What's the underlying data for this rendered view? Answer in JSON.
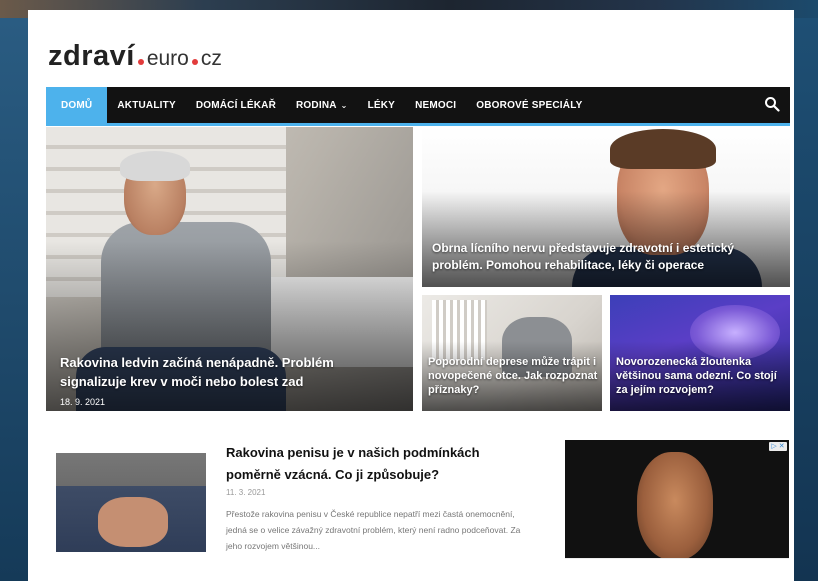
{
  "logo": {
    "main": "zdraví",
    "sub1": "euro",
    "sub2": "cz"
  },
  "nav": {
    "items": [
      {
        "label": "DOMŮ",
        "active": true
      },
      {
        "label": "AKTUALITY"
      },
      {
        "label": "DOMÁCÍ LÉKAŘ"
      },
      {
        "label": "RODINA",
        "dropdown": true
      },
      {
        "label": "LÉKY"
      },
      {
        "label": "NEMOCI"
      },
      {
        "label": "OBOROVÉ SPECIÁLY"
      }
    ],
    "search_icon": "search-icon",
    "dropdown_icon": "chevron-down-icon"
  },
  "hero": {
    "big": {
      "title": "Rakovina ledvin začíná nenápadně. Problém signalizuje krev v moči nebo bolest zad",
      "date": "18. 9. 2021"
    },
    "top_right": {
      "title": "Obrna lícního nervu představuje zdravotní i estetický problém. Pomohou rehabilitace, léky či operace"
    },
    "bottom_left": {
      "title": "Poporodní deprese může trápit i novopečené otce. Jak rozpoznat příznaky?"
    },
    "bottom_right": {
      "title": "Novorozenecká žloutenka většinou sama odezní. Co stojí za jejím rozvojem?"
    }
  },
  "article": {
    "title": "Rakovina penisu je v našich podmínkách poměrně vzácná. Co ji způsobuje?",
    "date": "11. 3. 2021",
    "excerpt": "Přestože rakovina penisu v České republice nepatří mezi častá onemocnění, jedná se o velice závažný zdravotní problém, který není radno podceňovat. Za jeho rozvojem většinou..."
  },
  "ad": {
    "choice_icon": "ad-choices-icon",
    "choice_label": "▷ ✕"
  },
  "colors": {
    "accent": "#4db2ec",
    "nav_bg": "#121212",
    "logo_dot": "#e23b3b"
  }
}
